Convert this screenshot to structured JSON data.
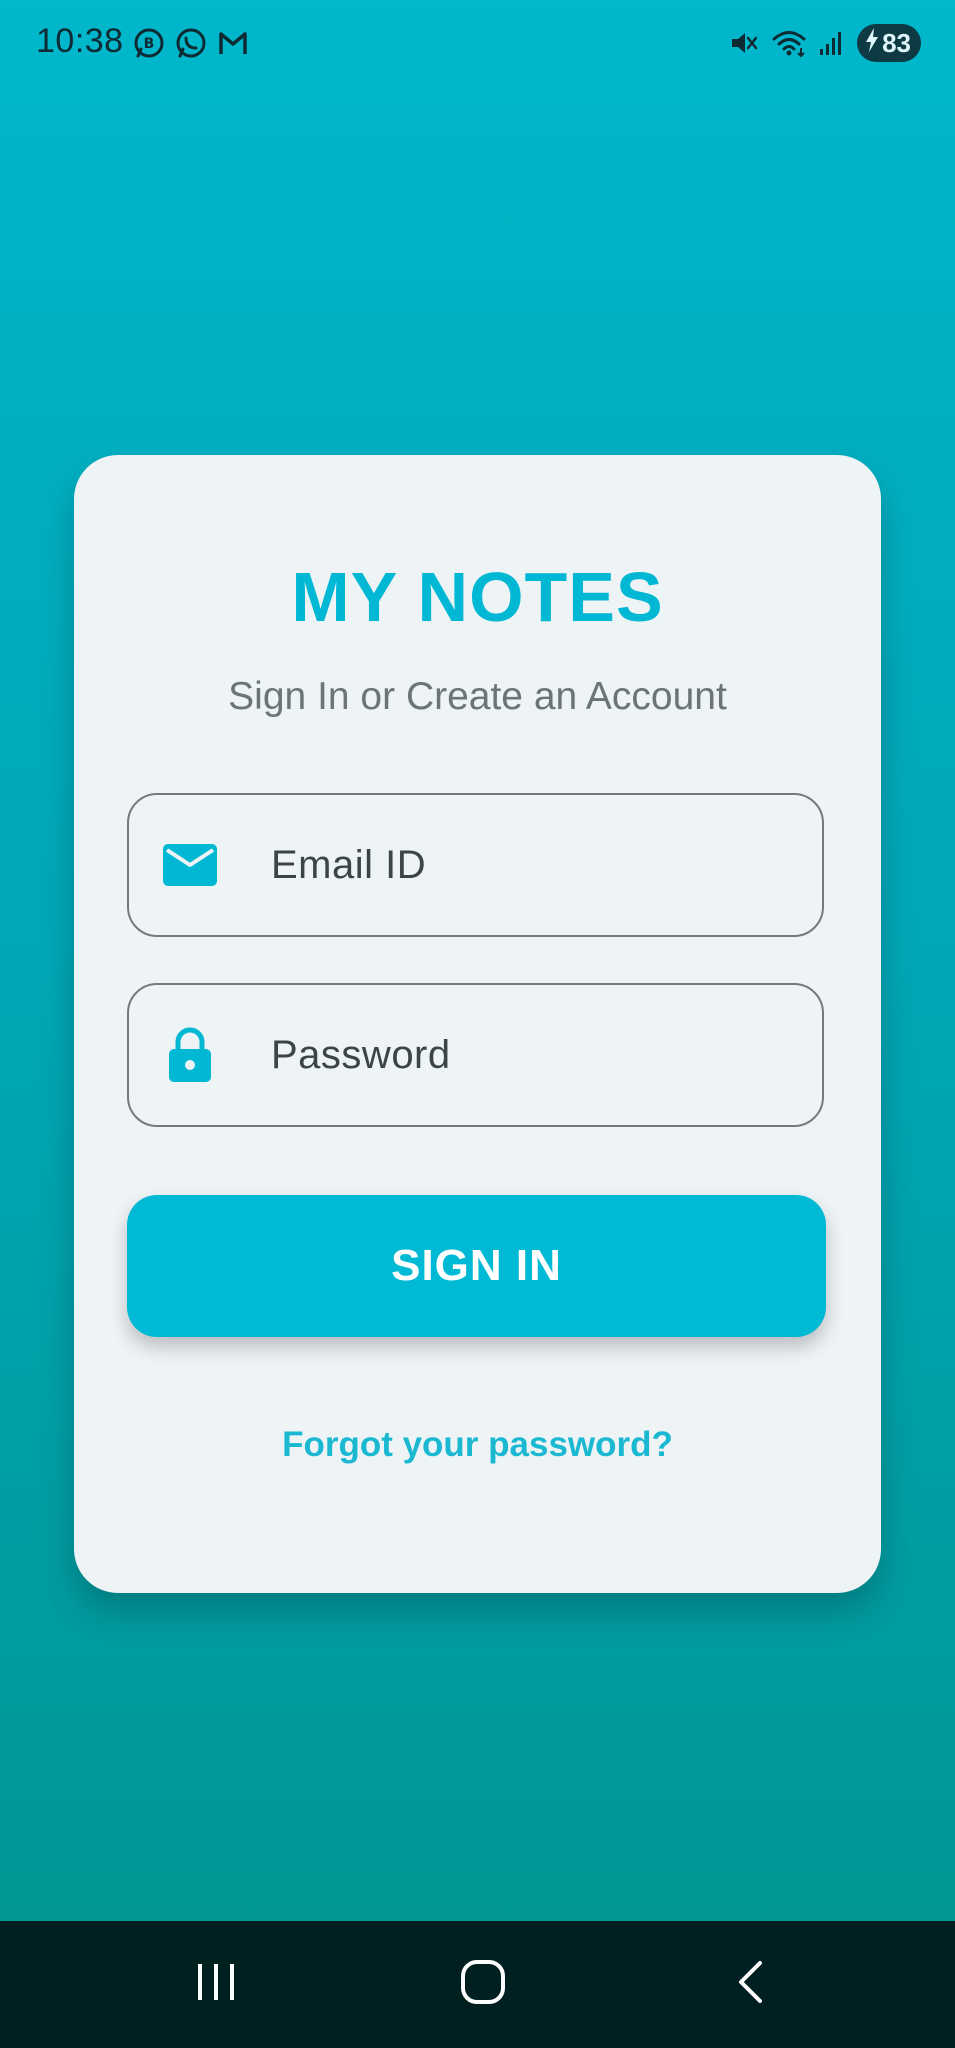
{
  "status_bar": {
    "time": "10:38",
    "left_icons": [
      "whatsapp-business-icon",
      "whatsapp-icon",
      "gmail-icon"
    ],
    "right_icons": [
      "mute-icon",
      "wifi-icon",
      "cell-signal-icon"
    ],
    "battery_level": "83",
    "battery_charging": true
  },
  "login_card": {
    "title": "MY NOTES",
    "subtitle": "Sign In or Create an Account",
    "email_field": {
      "placeholder": "Email ID",
      "value": "",
      "icon": "mail-icon"
    },
    "password_field": {
      "placeholder": "Password",
      "value": "",
      "icon": "lock-icon"
    },
    "sign_in_label": "SIGN IN",
    "forgot_password_label": "Forgot your password?"
  },
  "nav_bar": {
    "buttons": [
      "recents-icon",
      "home-icon",
      "back-icon"
    ]
  },
  "colors": {
    "accent": "#00bad5",
    "background_top": "#00b7cb",
    "background_bottom": "#00958f",
    "card": "#eef3f6",
    "nav_bar": "#001f21"
  }
}
